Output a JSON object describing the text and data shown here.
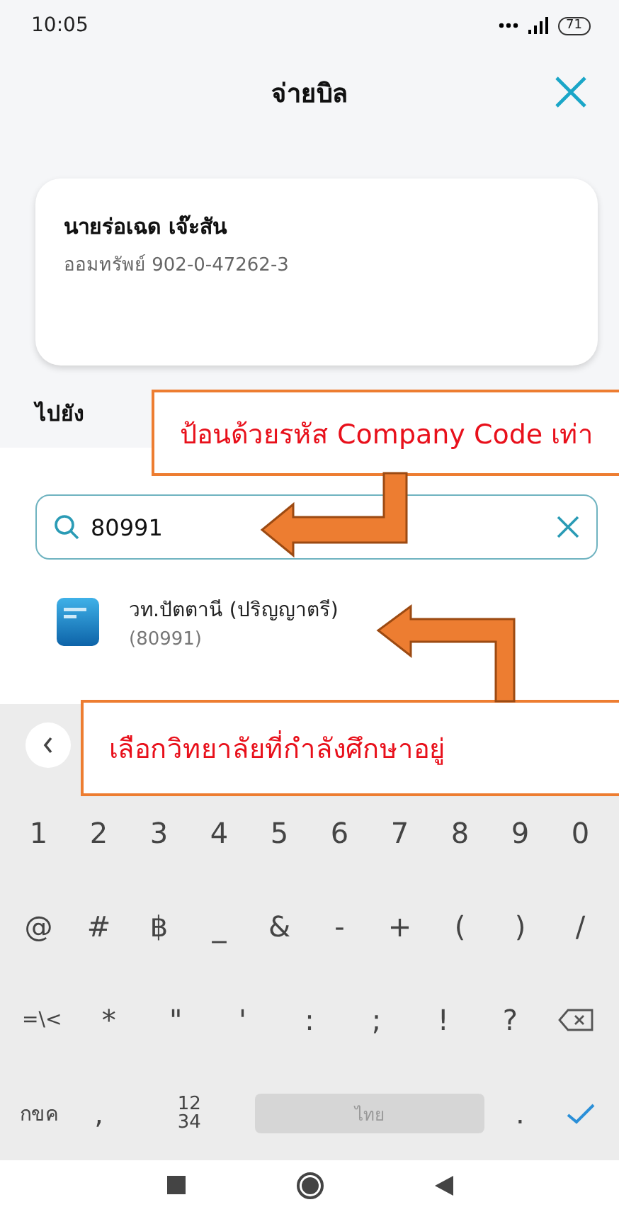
{
  "status_bar": {
    "time": "10:05",
    "battery": "71"
  },
  "header": {
    "title": "จ่ายบิล"
  },
  "from_card": {
    "name": "นายร่อเฉด เจ๊ะสัน",
    "account": "ออมทรัพย์ 902-0-47262-3"
  },
  "to_label": "ไปยัง",
  "search": {
    "value": "80991"
  },
  "results": [
    {
      "name": "วท.ปัตตานี (ปริญญาตรี)",
      "code": "(80991)"
    }
  ],
  "keyboard": {
    "rows": [
      [
        {
          "kind": "char",
          "label": "1"
        },
        {
          "kind": "char",
          "label": "2"
        },
        {
          "kind": "char",
          "label": "3"
        },
        {
          "kind": "char",
          "label": "4"
        },
        {
          "kind": "char",
          "label": "5"
        },
        {
          "kind": "char",
          "label": "6"
        },
        {
          "kind": "char",
          "label": "7"
        },
        {
          "kind": "char",
          "label": "8"
        },
        {
          "kind": "char",
          "label": "9"
        },
        {
          "kind": "char",
          "label": "0"
        }
      ],
      [
        {
          "kind": "char",
          "label": "@"
        },
        {
          "kind": "char",
          "label": "#"
        },
        {
          "kind": "char",
          "label": "฿"
        },
        {
          "kind": "char",
          "label": "_"
        },
        {
          "kind": "char",
          "label": "&"
        },
        {
          "kind": "char",
          "label": "-"
        },
        {
          "kind": "char",
          "label": "+"
        },
        {
          "kind": "char",
          "label": "("
        },
        {
          "kind": "char",
          "label": ")"
        },
        {
          "kind": "char",
          "label": "/"
        }
      ],
      [
        {
          "kind": "small",
          "label": "=\\<"
        },
        {
          "kind": "char",
          "label": "*"
        },
        {
          "kind": "char",
          "label": "\""
        },
        {
          "kind": "char",
          "label": "'"
        },
        {
          "kind": "char",
          "label": ":"
        },
        {
          "kind": "char",
          "label": ";"
        },
        {
          "kind": "char",
          "label": "!"
        },
        {
          "kind": "char",
          "label": "?"
        },
        {
          "kind": "backspace"
        }
      ]
    ],
    "bottom_bar": [
      {
        "kind": "small",
        "label": "กขค"
      },
      {
        "kind": "char",
        "label": ","
      },
      {
        "kind": "stack",
        "label": "12\n34"
      },
      {
        "kind": "space",
        "label": "ไทย"
      },
      {
        "kind": "char",
        "label": "."
      },
      {
        "kind": "enter"
      }
    ]
  },
  "annotations": [
    {
      "text": "ป้อนด้วยรหัส Company Code เท่า"
    },
    {
      "text": "เลือกวิทยาลัยที่กำลังศึกษาอยู่"
    }
  ]
}
